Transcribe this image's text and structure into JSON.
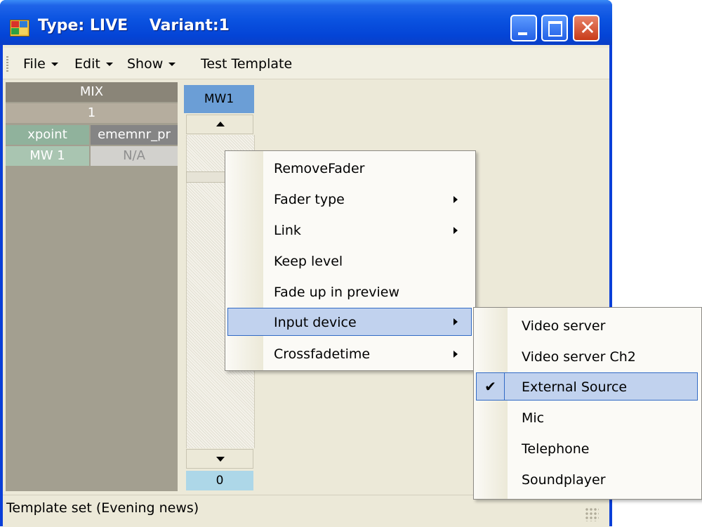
{
  "window": {
    "title": "Type: LIVE    Variant:1",
    "minimize_icon": "minimize-icon",
    "maximize_icon": "maximize-icon",
    "close_icon": "close-icon",
    "close_glyph": "✕"
  },
  "menubar": {
    "items": [
      {
        "label": "File",
        "has_dropdown": true
      },
      {
        "label": "Edit",
        "has_dropdown": true
      },
      {
        "label": "Show",
        "has_dropdown": true
      },
      {
        "label": "Test Template",
        "has_dropdown": false
      }
    ]
  },
  "mix_panel": {
    "header": "MIX",
    "number": "1",
    "columns": [
      "xpoint",
      "ememnr_pr"
    ],
    "row": [
      "MW 1",
      "N/A"
    ]
  },
  "fader": {
    "name": "MW1",
    "value": "0"
  },
  "context_menu": {
    "items": [
      {
        "label": "RemoveFader",
        "submenu": false
      },
      {
        "label": "Fader type",
        "submenu": true
      },
      {
        "label": "Link",
        "submenu": true
      },
      {
        "label": "Keep level",
        "submenu": false
      },
      {
        "label": "Fade up in preview",
        "submenu": false
      },
      {
        "label": "Input device",
        "submenu": true,
        "highlighted": true
      },
      {
        "label": "Crossfadetime",
        "submenu": true
      }
    ]
  },
  "input_device_menu": {
    "items": [
      {
        "label": "Video server",
        "checked": false
      },
      {
        "label": "Video server Ch2",
        "checked": false
      },
      {
        "label": "External Source",
        "checked": true,
        "highlighted": true
      },
      {
        "label": "Mic",
        "checked": false
      },
      {
        "label": "Telephone",
        "checked": false
      },
      {
        "label": "Soundplayer",
        "checked": false
      }
    ],
    "check_glyph": "✔"
  },
  "statusbar": {
    "text": "Template set (Evening news)"
  },
  "colors": {
    "titlebar": "#0a52e0",
    "highlight": "#c1d2ee",
    "highlight_border": "#316ac5",
    "fader_header": "#6b9ed6",
    "value_box": "#add7e8"
  }
}
